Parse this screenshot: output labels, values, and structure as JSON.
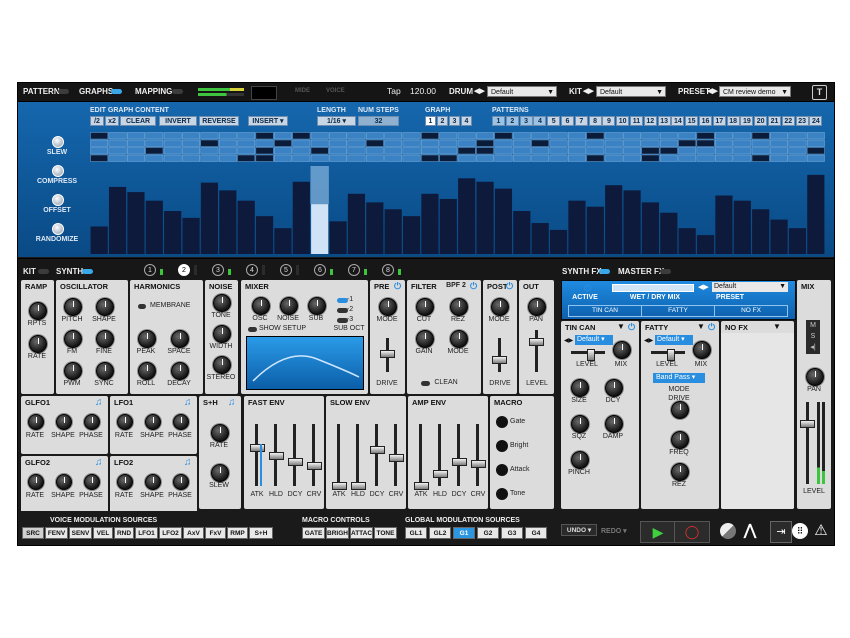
{
  "topbar": {
    "pattern": "PATTERN",
    "graphs": "GRAPHS",
    "mapping": "MAPPING",
    "mide": "MIDE",
    "voice": "VOICE",
    "tap": "Tap",
    "tempo": "120.00",
    "drum_label": "DRUM",
    "drum_value": "Default",
    "kit_label": "KIT",
    "kit_value": "Default",
    "preset_label": "PRESET",
    "preset_value": "CM review demo"
  },
  "graph": {
    "edit_title": "EDIT GRAPH CONTENT",
    "buttons": [
      "/2",
      "x2",
      "CLEAR",
      "INVERT",
      "REVERSE"
    ],
    "insert": "INSERT",
    "length_label": "LENGTH",
    "length_value": "1/16",
    "steps_label": "NUM STEPS",
    "steps_value": "32",
    "graph_label": "GRAPH",
    "graph_numbers": [
      "1",
      "2",
      "3",
      "4"
    ],
    "patterns_label": "PATTERNS",
    "pattern_numbers": [
      "1",
      "2",
      "3",
      "4",
      "5",
      "6",
      "7",
      "8",
      "9",
      "10",
      "11",
      "12",
      "13",
      "14",
      "15",
      "16",
      "17",
      "18",
      "19",
      "20",
      "21",
      "22",
      "23",
      "24"
    ],
    "side_labels": [
      "SLEW",
      "COMPRESS",
      "OFFSET",
      "RANDOMIZE"
    ],
    "bars": [
      0.32,
      0.78,
      0.72,
      0.62,
      0.5,
      0.42,
      0.83,
      0.74,
      0.62,
      0.44,
      0.3,
      0.84,
      0.58,
      0.38,
      0.7,
      0.6,
      0.52,
      0.44,
      0.7,
      0.64,
      0.88,
      0.84,
      0.76,
      0.5,
      0.36,
      0.28,
      0.62,
      0.55,
      0.8,
      0.74,
      0.6,
      0.48,
      0.3,
      0.22,
      0.68,
      0.62,
      0.52,
      0.4,
      0.3,
      0.92
    ],
    "highlight_index": 12
  },
  "kitbar": {
    "kit": "KIT",
    "synth": "SYNTH",
    "slots": [
      "1",
      "2",
      "3",
      "4",
      "5",
      "6",
      "7",
      "8"
    ],
    "synth_fx": "SYNTH FX",
    "master_fx": "MASTER FX"
  },
  "ramp": {
    "title": "RAMP",
    "rpts": "RPTS",
    "rate": "RATE"
  },
  "osc": {
    "title": "OSCILLATOR",
    "labels": [
      "PITCH",
      "SHAPE",
      "FM",
      "FINE",
      "PWM",
      "SYNC"
    ]
  },
  "harm": {
    "title": "HARMONICS",
    "membrane": "MEMBRANE",
    "labels": [
      "PEAK",
      "SPACE",
      "ROLL",
      "DECAY"
    ]
  },
  "noise": {
    "title": "NOISE",
    "labels": [
      "TONE",
      "WIDTH",
      "STEREO"
    ]
  },
  "mixer": {
    "title": "MIXER",
    "labels": [
      "OSC",
      "NOISE",
      "SUB"
    ],
    "show_setup": "SHOW SETUP",
    "sub_oct": "SUB OCT",
    "octs": [
      "-1",
      "-2",
      "-3"
    ]
  },
  "pre": {
    "title": "PRE",
    "mode": "MODE",
    "drive": "DRIVE"
  },
  "filter": {
    "title": "FILTER",
    "type": "BPF 2",
    "labels": [
      "CUT",
      "REZ",
      "GAIN",
      "MODE"
    ],
    "clean": "CLEAN"
  },
  "post": {
    "title": "POST",
    "mode": "MODE",
    "drive": "DRIVE"
  },
  "out": {
    "title": "OUT",
    "pan": "PAN",
    "level": "LEVEL"
  },
  "glfo1": {
    "title": "GLFO1",
    "labels": [
      "RATE",
      "SHAPE",
      "PHASE"
    ]
  },
  "lfo1": {
    "title": "LFO1",
    "labels": [
      "RATE",
      "SHAPE",
      "PHASE"
    ]
  },
  "glfo2": {
    "title": "GLFO2",
    "labels": [
      "RATE",
      "SHAPE",
      "PHASE"
    ]
  },
  "lfo2": {
    "title": "LFO2",
    "labels": [
      "RATE",
      "SHAPE",
      "PHASE"
    ]
  },
  "sh": {
    "title": "S+H",
    "rate": "RATE",
    "slew": "SLEW"
  },
  "fastenv": {
    "title": "FAST ENV",
    "labels": [
      "ATK",
      "HLD",
      "DCY",
      "CRV"
    ]
  },
  "slowenv": {
    "title": "SLOW ENV",
    "labels": [
      "ATK",
      "HLD",
      "DCY",
      "CRV"
    ]
  },
  "ampenv": {
    "title": "AMP ENV",
    "labels": [
      "ATK",
      "HLD",
      "DCY",
      "CRV"
    ]
  },
  "macro": {
    "title": "MACRO",
    "labels": [
      "Gate",
      "Bright",
      "Attack",
      "Tone"
    ]
  },
  "bottom": {
    "voice_title": "VOICE MODULATION SOURCES",
    "voice_items": [
      "SRC",
      "FENV",
      "SENV",
      "VEL",
      "RND",
      "LFO1",
      "LFO2",
      "AxV",
      "FxV",
      "RMP",
      "S+H"
    ],
    "macro_title": "MACRO CONTROLS",
    "macro_items": [
      "GATE",
      "BRIGH",
      "ATTAC",
      "TONE"
    ],
    "global_title": "GLOBAL MODULATION SOURCES",
    "global_items": [
      "GL1",
      "GL2",
      "G1",
      "G2",
      "G3",
      "G4"
    ],
    "undo": "UNDO",
    "redo": "REDO"
  },
  "fx": {
    "active": "ACTIVE",
    "wet_dry": "WET / DRY MIX",
    "preset_label": "PRESET",
    "preset_value": "Default",
    "slot_names": [
      "TIN CAN",
      "FATTY",
      "NO FX"
    ],
    "tincan_title": "TIN CAN",
    "tincan_preset": "Default",
    "tincan_labels": [
      "LEVEL",
      "MIX",
      "SIZE",
      "DCY",
      "SQZ",
      "DAMP",
      "PINCH"
    ],
    "fatty_title": "FATTY",
    "fatty_preset": "Default",
    "fatty_labels": [
      "LEVEL",
      "MIX",
      "MODE",
      "DRIVE",
      "FREQ",
      "REZ"
    ],
    "fatty_mode": "Band Pass",
    "nofx_title": "NO FX"
  },
  "mix": {
    "title": "MIX",
    "m": "M",
    "s": "S",
    "pan": "PAN",
    "level": "LEVEL"
  }
}
